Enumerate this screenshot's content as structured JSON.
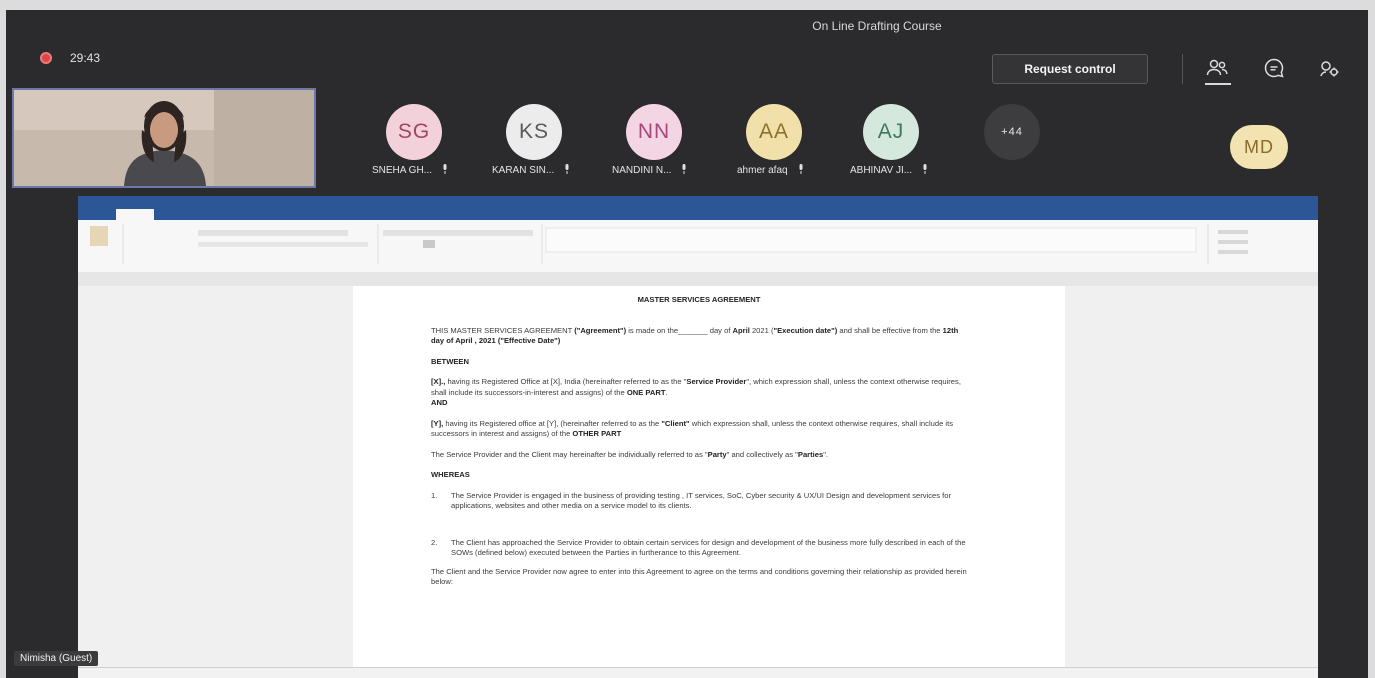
{
  "meeting": {
    "title": "On Line Drafting Course",
    "timer": "29:43",
    "request_control_label": "Request control",
    "icons": [
      "people-icon",
      "chat-icon",
      "device-settings-icon"
    ]
  },
  "self_video": {
    "name_tag": "Nimisha (Guest)"
  },
  "participants": [
    {
      "initials": "SG",
      "name": "SNEHA GH...",
      "bg": "#f3d1da",
      "fg": "#9e4760"
    },
    {
      "initials": "KS",
      "name": "KARAN SIN...",
      "bg": "#ececec",
      "fg": "#5a5a5a"
    },
    {
      "initials": "NN",
      "name": "NANDINI N...",
      "bg": "#f4d5e3",
      "fg": "#a6497a"
    },
    {
      "initials": "AA",
      "name": "ahmer afaq",
      "bg": "#f1e0a9",
      "fg": "#8c7230"
    },
    {
      "initials": "AJ",
      "name": "ABHINAV JI...",
      "bg": "#d5e8dd",
      "fg": "#3f7a5a"
    }
  ],
  "overflow_count": "+44",
  "presenter_initials": "MD",
  "document": {
    "heading": "MASTER SERVICES AGREEMENT",
    "intro_a": "THIS MASTER SERVICES AGREEMENT ",
    "intro_b": "(\"Agreement\")",
    "intro_c": " is made on the_______ day of ",
    "intro_d": "April",
    "intro_e": " 2021 (",
    "intro_f": "\"Execution date\")",
    "intro_g": " and shall be effective from the ",
    "intro_h": "12th day of April , 2021 (\"Effective Date\")",
    "between": "BETWEEN",
    "party1_a": "[X].,",
    "party1_b": " having its Registered Office at [X], India (hereinafter referred to as the \"",
    "party1_c": "Service Provider",
    "party1_d": "\", which expression shall, unless the context otherwise requires, shall include its successors-in-interest and assigns) of the ",
    "party1_e": "ONE PART",
    "party1_f": ".",
    "and": "AND",
    "party2_a": "[Y],",
    "party2_b": " having its Registered office at [Y], (hereinafter referred to as the ",
    "party2_c": "\"Client\"",
    "party2_d": " which expression shall, unless the context otherwise requires, shall include its successors in interest and assigns) of the ",
    "party2_e": "OTHER PART",
    "parties_a": "The Service Provider and the Client may hereinafter be individually referred to as \"",
    "parties_b": "Party",
    "parties_c": "\" and collectively as \"",
    "parties_d": "Parties",
    "parties_e": "\".",
    "whereas": "WHEREAS",
    "item1_num": "1.",
    "item1": "The Service Provider is engaged in the business of providing testing , IT services, SoC, Cyber security & UX/UI Design and development services for applications, websites and other media on a service model to its clients.",
    "item2_num": "2.",
    "item2": "The Client has approached the Service Provider to obtain certain services for design and development of the business more fully described in each of the SOWs (defined below) executed between the Parties in furtherance to this Agreement.",
    "closing": "The Client and the Service Provider now agree to enter into this Agreement to agree on the terms and conditions governing their relationship as provided herein below:"
  }
}
